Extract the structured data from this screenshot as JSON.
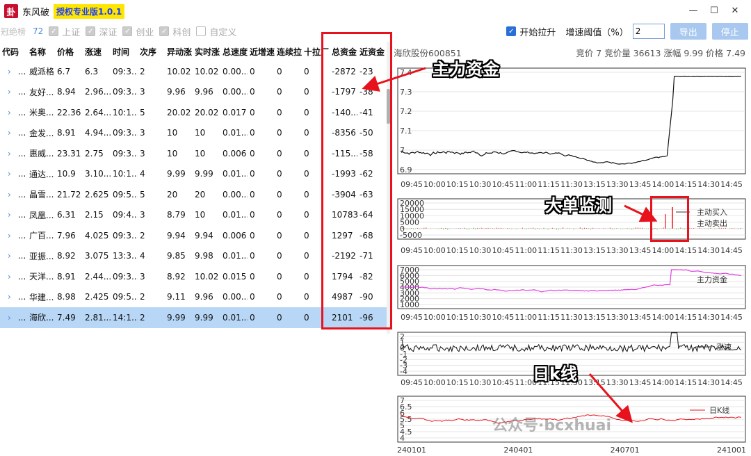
{
  "app": {
    "title": "东风破",
    "license": "授权专业版1.0.1",
    "logo": "卦"
  },
  "window_controls": {
    "minimize": "—",
    "maximize": "☐",
    "close": "✕"
  },
  "toolbar": {
    "brand": "冠绝榜",
    "count": "72",
    "filters": [
      {
        "label": "上证",
        "checked": true
      },
      {
        "label": "深证",
        "checked": true
      },
      {
        "label": "创业",
        "checked": true
      },
      {
        "label": "科创",
        "checked": true
      },
      {
        "label": "自定义",
        "checked": false
      }
    ],
    "start_label": "开始拉升",
    "threshold_label": "增速阈值（%）",
    "threshold_value": "2",
    "export_label": "导出",
    "stop_label": "停止"
  },
  "table": {
    "headers": [
      "代码",
      "名称",
      "价格",
      "涨速",
      "时间",
      "次序",
      "异动涨",
      "实时涨",
      "总速度",
      "近增速",
      "连续拉",
      "十拉厂",
      "总资金",
      "近资金"
    ],
    "rows": [
      [
        "...",
        "威派格",
        "6.7",
        "6.3",
        "09:3...",
        "2",
        "10.02",
        "10.02",
        "0.00...",
        "0",
        "0",
        "0",
        "-2872",
        "-23"
      ],
      [
        "...",
        "友好...",
        "8.94",
        "2.96...",
        "09:3...",
        "3",
        "9.96",
        "9.96",
        "0.00...",
        "0",
        "0",
        "0",
        "-1797",
        "-38"
      ],
      [
        "...",
        "米奥...",
        "22.36",
        "2.64...",
        "10:1...",
        "5",
        "20.02",
        "20.02",
        "0.017",
        "0",
        "0",
        "0",
        "-140...",
        "-41"
      ],
      [
        "...",
        "金发...",
        "8.91",
        "4.94...",
        "09:3...",
        "3",
        "10",
        "10",
        "0.01...",
        "0",
        "0",
        "0",
        "-8356",
        "-50"
      ],
      [
        "...",
        "惠威...",
        "23.31",
        "2.75",
        "09:3...",
        "3",
        "10",
        "10",
        "0.006",
        "0",
        "0",
        "0",
        "-115...",
        "-58"
      ],
      [
        "...",
        "通达...",
        "10.9",
        "3.10...",
        "10:1...",
        "4",
        "9.99",
        "9.99",
        "0.01...",
        "0",
        "0",
        "0",
        "-1993",
        "-62"
      ],
      [
        "...",
        "晶雪...",
        "21.72",
        "2.625",
        "09:5...",
        "5",
        "20",
        "20",
        "0.00...",
        "0",
        "0",
        "0",
        "-3904",
        "-63"
      ],
      [
        "...",
        "凤凰...",
        "6.31",
        "2.15",
        "09:4...",
        "3",
        "8.79",
        "10",
        "0.01...",
        "0",
        "0",
        "0",
        "10783",
        "-64"
      ],
      [
        "...",
        "广百...",
        "7.96",
        "4.025",
        "09:3...",
        "2",
        "9.94",
        "9.94",
        "0.006",
        "0",
        "0",
        "0",
        "1297",
        "-68"
      ],
      [
        "...",
        "亚振...",
        "8.92",
        "3.075",
        "13:3...",
        "4",
        "9.85",
        "9.98",
        "0.01...",
        "0",
        "0",
        "0",
        "-2192",
        "-71"
      ],
      [
        "...",
        "天洋...",
        "8.91",
        "2.44...",
        "09:3...",
        "3",
        "8.92",
        "10.02",
        "0.015",
        "0",
        "0",
        "0",
        "1794",
        "-82"
      ],
      [
        "...",
        "华建...",
        "8.98",
        "2.425",
        "09:5...",
        "2",
        "9.11",
        "9.96",
        "0.00...",
        "0",
        "0",
        "0",
        "4987",
        "-90"
      ],
      [
        "...",
        "海欣...",
        "7.49",
        "2.81...",
        "14:1...",
        "2",
        "9.99",
        "9.99",
        "0.01...",
        "0",
        "0",
        "0",
        "2101",
        "-96"
      ]
    ],
    "selected_index": 12
  },
  "stock": {
    "name": "海欣股份600851",
    "quote": "竞价 7  竞价量 36613  涨幅 9.99  价格 7.49"
  },
  "time_ticks": [
    "09:45",
    "10:00",
    "10:15",
    "10:30",
    "10:45",
    "11:00",
    "11:15",
    "11:30",
    "13:15",
    "13:30",
    "13:45",
    "14:00",
    "14:15",
    "14:30",
    "14:45"
  ],
  "price_chart": {
    "y_ticks": [
      "7.4",
      "7.3",
      "7.2",
      "7.1",
      "7",
      "6.9"
    ],
    "ylim": [
      6.82,
      7.52
    ],
    "close": 7.49
  },
  "bigorder_chart": {
    "y_ticks": [
      "20000",
      "15000",
      "10000",
      "5000",
      "0",
      "-5000"
    ],
    "legend_buy": "主动买入",
    "legend_sell": "主动卖出"
  },
  "fund_chart": {
    "y_ticks": [
      "7000",
      "6000",
      "5000",
      "4000",
      "3000",
      "2000",
      "1000"
    ],
    "legend": "主力资金"
  },
  "speed_chart": {
    "y_ticks": [
      "2",
      "1",
      "0",
      "-1",
      "-2",
      "-3",
      "-4"
    ],
    "legend": "涨速"
  },
  "kline_chart": {
    "y_ticks": [
      "7",
      "6.5",
      "6",
      "5.5",
      "5",
      "4.5",
      "4"
    ],
    "x_ticks": [
      "240101",
      "240401",
      "240701",
      "241001"
    ],
    "legend": "日K线"
  },
  "annotations": {
    "fund": "主力资金",
    "bigorder": "大单监测",
    "kline": "日k线"
  },
  "watermark": "公众号·bcxhuai",
  "colors": {
    "accent": "#2a6ed8",
    "red": "#e8121c",
    "fund_line": "#e040e0",
    "buy": "#e8121c",
    "sell": "#27c427"
  }
}
